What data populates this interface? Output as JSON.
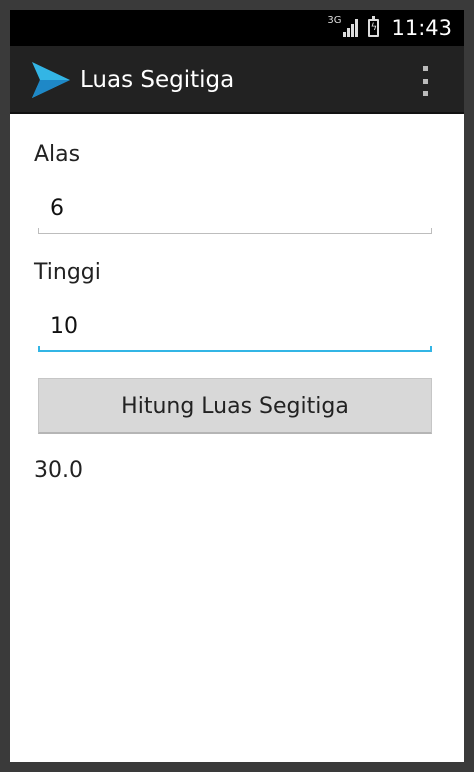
{
  "status_bar": {
    "network": "3G",
    "time": "11:43"
  },
  "action_bar": {
    "title": "Luas Segitiga",
    "icon": "paper-plane-icon",
    "accent": "#33b5e5"
  },
  "form": {
    "alas_label": "Alas",
    "alas_value": "6",
    "tinggi_label": "Tinggi",
    "tinggi_value": "10",
    "button_label": "Hitung Luas Segitiga",
    "result": "30.0"
  }
}
